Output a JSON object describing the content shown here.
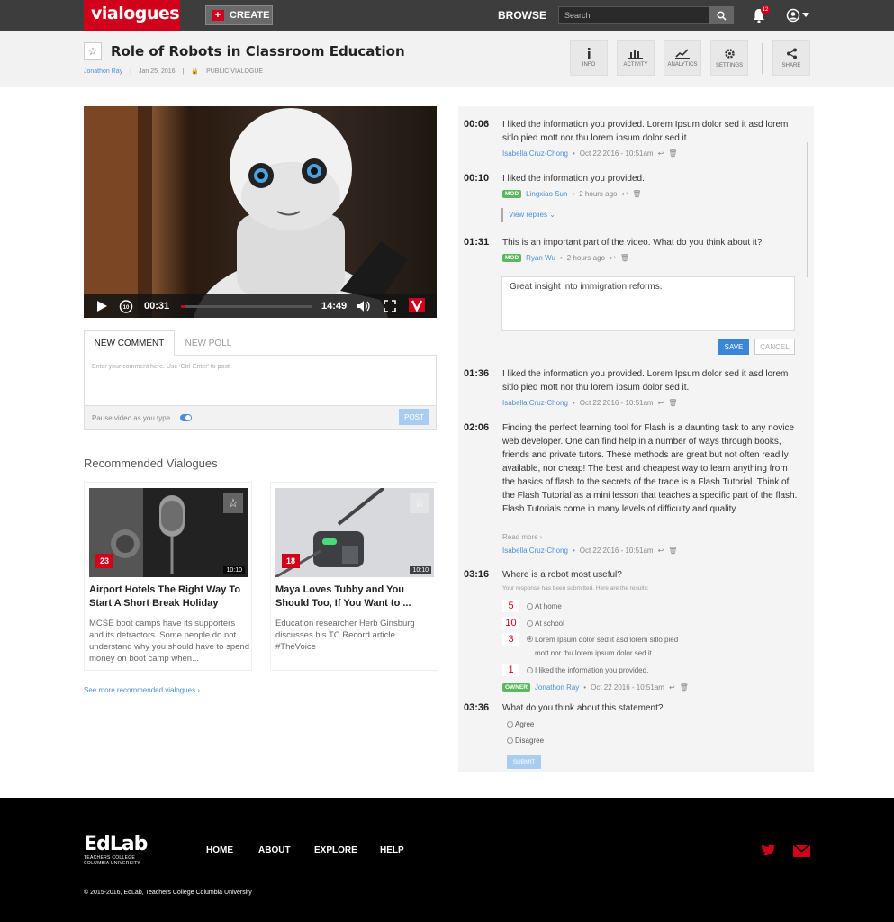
{
  "colors": {
    "brand": "#d0021b",
    "link": "#4a90d9",
    "mod_badge": "#5cb85c",
    "primary_button": "#3a87d6"
  },
  "topnav": {
    "logo": "vialogues",
    "create_label": "CREATE",
    "browse_label": "BROWSE",
    "search_placeholder": "Search",
    "notification_count": "12"
  },
  "header": {
    "title": "Role of Robots in Classroom Education",
    "author": "Jonathon Ray",
    "date": "Jan 25, 2016",
    "visibility": "PUBLIC VIALOGUE",
    "tools": [
      {
        "label": "INFO",
        "icon": "info-icon"
      },
      {
        "label": "ACTIVITY",
        "icon": "bar-chart-icon"
      },
      {
        "label": "ANALYTICS",
        "icon": "line-chart-icon"
      },
      {
        "label": "SETTINGS",
        "icon": "gear-icon"
      },
      {
        "label": "SHARE",
        "icon": "share-icon"
      }
    ]
  },
  "player": {
    "current_time": "00:31",
    "duration": "14:49",
    "progress_fraction": 0.035
  },
  "composer": {
    "tab_comment": "NEW COMMENT",
    "tab_poll": "NEW POLL",
    "placeholder": "Enter your comment here. Use 'Ctrl-Enter' to post.",
    "pause_label": "Pause video as you type",
    "post_label": "POST"
  },
  "recommended": {
    "heading": "Recommended Vialogues",
    "see_more": "See more recommended vialogues",
    "cards": [
      {
        "title": "Airport Hotels The Right Way To Start A Short Break Holiday",
        "description": "MCSE boot camps have its supporters and its detractors. Some people do not understand why you should have to spend money on boot camp when...",
        "count": "23",
        "duration": "10:10"
      },
      {
        "title": "Maya Loves Tubby and You Should Too, If You Want to ...",
        "description": "Education researcher Herb Ginsburg discusses his TC Record article. #TheVoice",
        "count": "18",
        "duration": "10:10"
      }
    ]
  },
  "comments": [
    {
      "time": "00:06",
      "text": "I liked the information you provided. Lorem Ipsum dolor sed it asd lorem sitlo pied mott nor thu lorem ipsum dolor sed it.",
      "author": "Isabella Cruz-Chong",
      "date": "Oct 22 2016 - 10:51am"
    },
    {
      "time": "00:10",
      "text": "I liked the information you provided.",
      "badge": "MOD",
      "author": "Lingxiao Sun",
      "date": "2 hours ago",
      "view_replies": "View replies"
    },
    {
      "time": "01:31",
      "text": "This is an important part of the video. What do you think about it?",
      "badge": "MOD",
      "author": "Ryan Wu",
      "date": "2 hours ago"
    },
    {
      "time": "01:36",
      "text": "I liked the information you provided. Lorem Ipsum dolor sed it asd lorem sitlo pied mott nor thu lorem ipsum dolor sed it.",
      "author": "Isabella Cruz-Chong",
      "date": "Oct 22 2016 - 10:51am"
    },
    {
      "time": "02:06",
      "text": "Finding the perfect learning tool for Flash is a daunting task to any novice web developer. One can find help in a number of ways through books, friends and private tutors. These methods are great but not often readily available, nor cheap! The best and cheapest way to learn anything from the basics of flash to the secrets of the trade is a Flash Tutorial. Think of the Flash Tutorial as a mini lesson that teaches a specific part of the flash. Flash Tutorials come in many levels of difficulty and quality.",
      "read_more": "Read more",
      "author": "Isabella Cruz-Chong",
      "date": "Oct 22 2016 - 10:51am"
    }
  ],
  "reply": {
    "text": "Great insight into immigration reforms.",
    "save_label": "SAVE",
    "cancel_label": "CANCEL"
  },
  "poll": {
    "time": "03:16",
    "question": "Where is a robot most useful?",
    "note": "Your response has been submitted. Here are the results:",
    "options": [
      {
        "count": "5",
        "label": "At home",
        "selected": false
      },
      {
        "count": "10",
        "label": "At school",
        "selected": false
      },
      {
        "count": "3",
        "label": "Lorem Ipsum dolor sed it asd lorem sitlo pied mott nor thu lorem ipsum dolor sed it.",
        "selected": true
      },
      {
        "count": "1",
        "label": "I liked the information you provided.",
        "selected": false
      }
    ],
    "badge": "OWNER",
    "author": "Jonathon Ray",
    "date": "Oct 22 2016 - 10:51am"
  },
  "question": {
    "time": "03:36",
    "text": "What do you think about this statement?",
    "options": [
      "Agree",
      "Disagree"
    ],
    "submit_label": "SUBMIT"
  },
  "footer": {
    "brand": "EdLab",
    "brand_sub1": "TEACHERS COLLEGE",
    "brand_sub2": "COLUMBIA UNIVERSITY",
    "nav": [
      "HOME",
      "ABOUT",
      "EXPLORE",
      "HELP"
    ],
    "copyright": "© 2015-2016, EdLab, Teachers College Columbia University"
  }
}
